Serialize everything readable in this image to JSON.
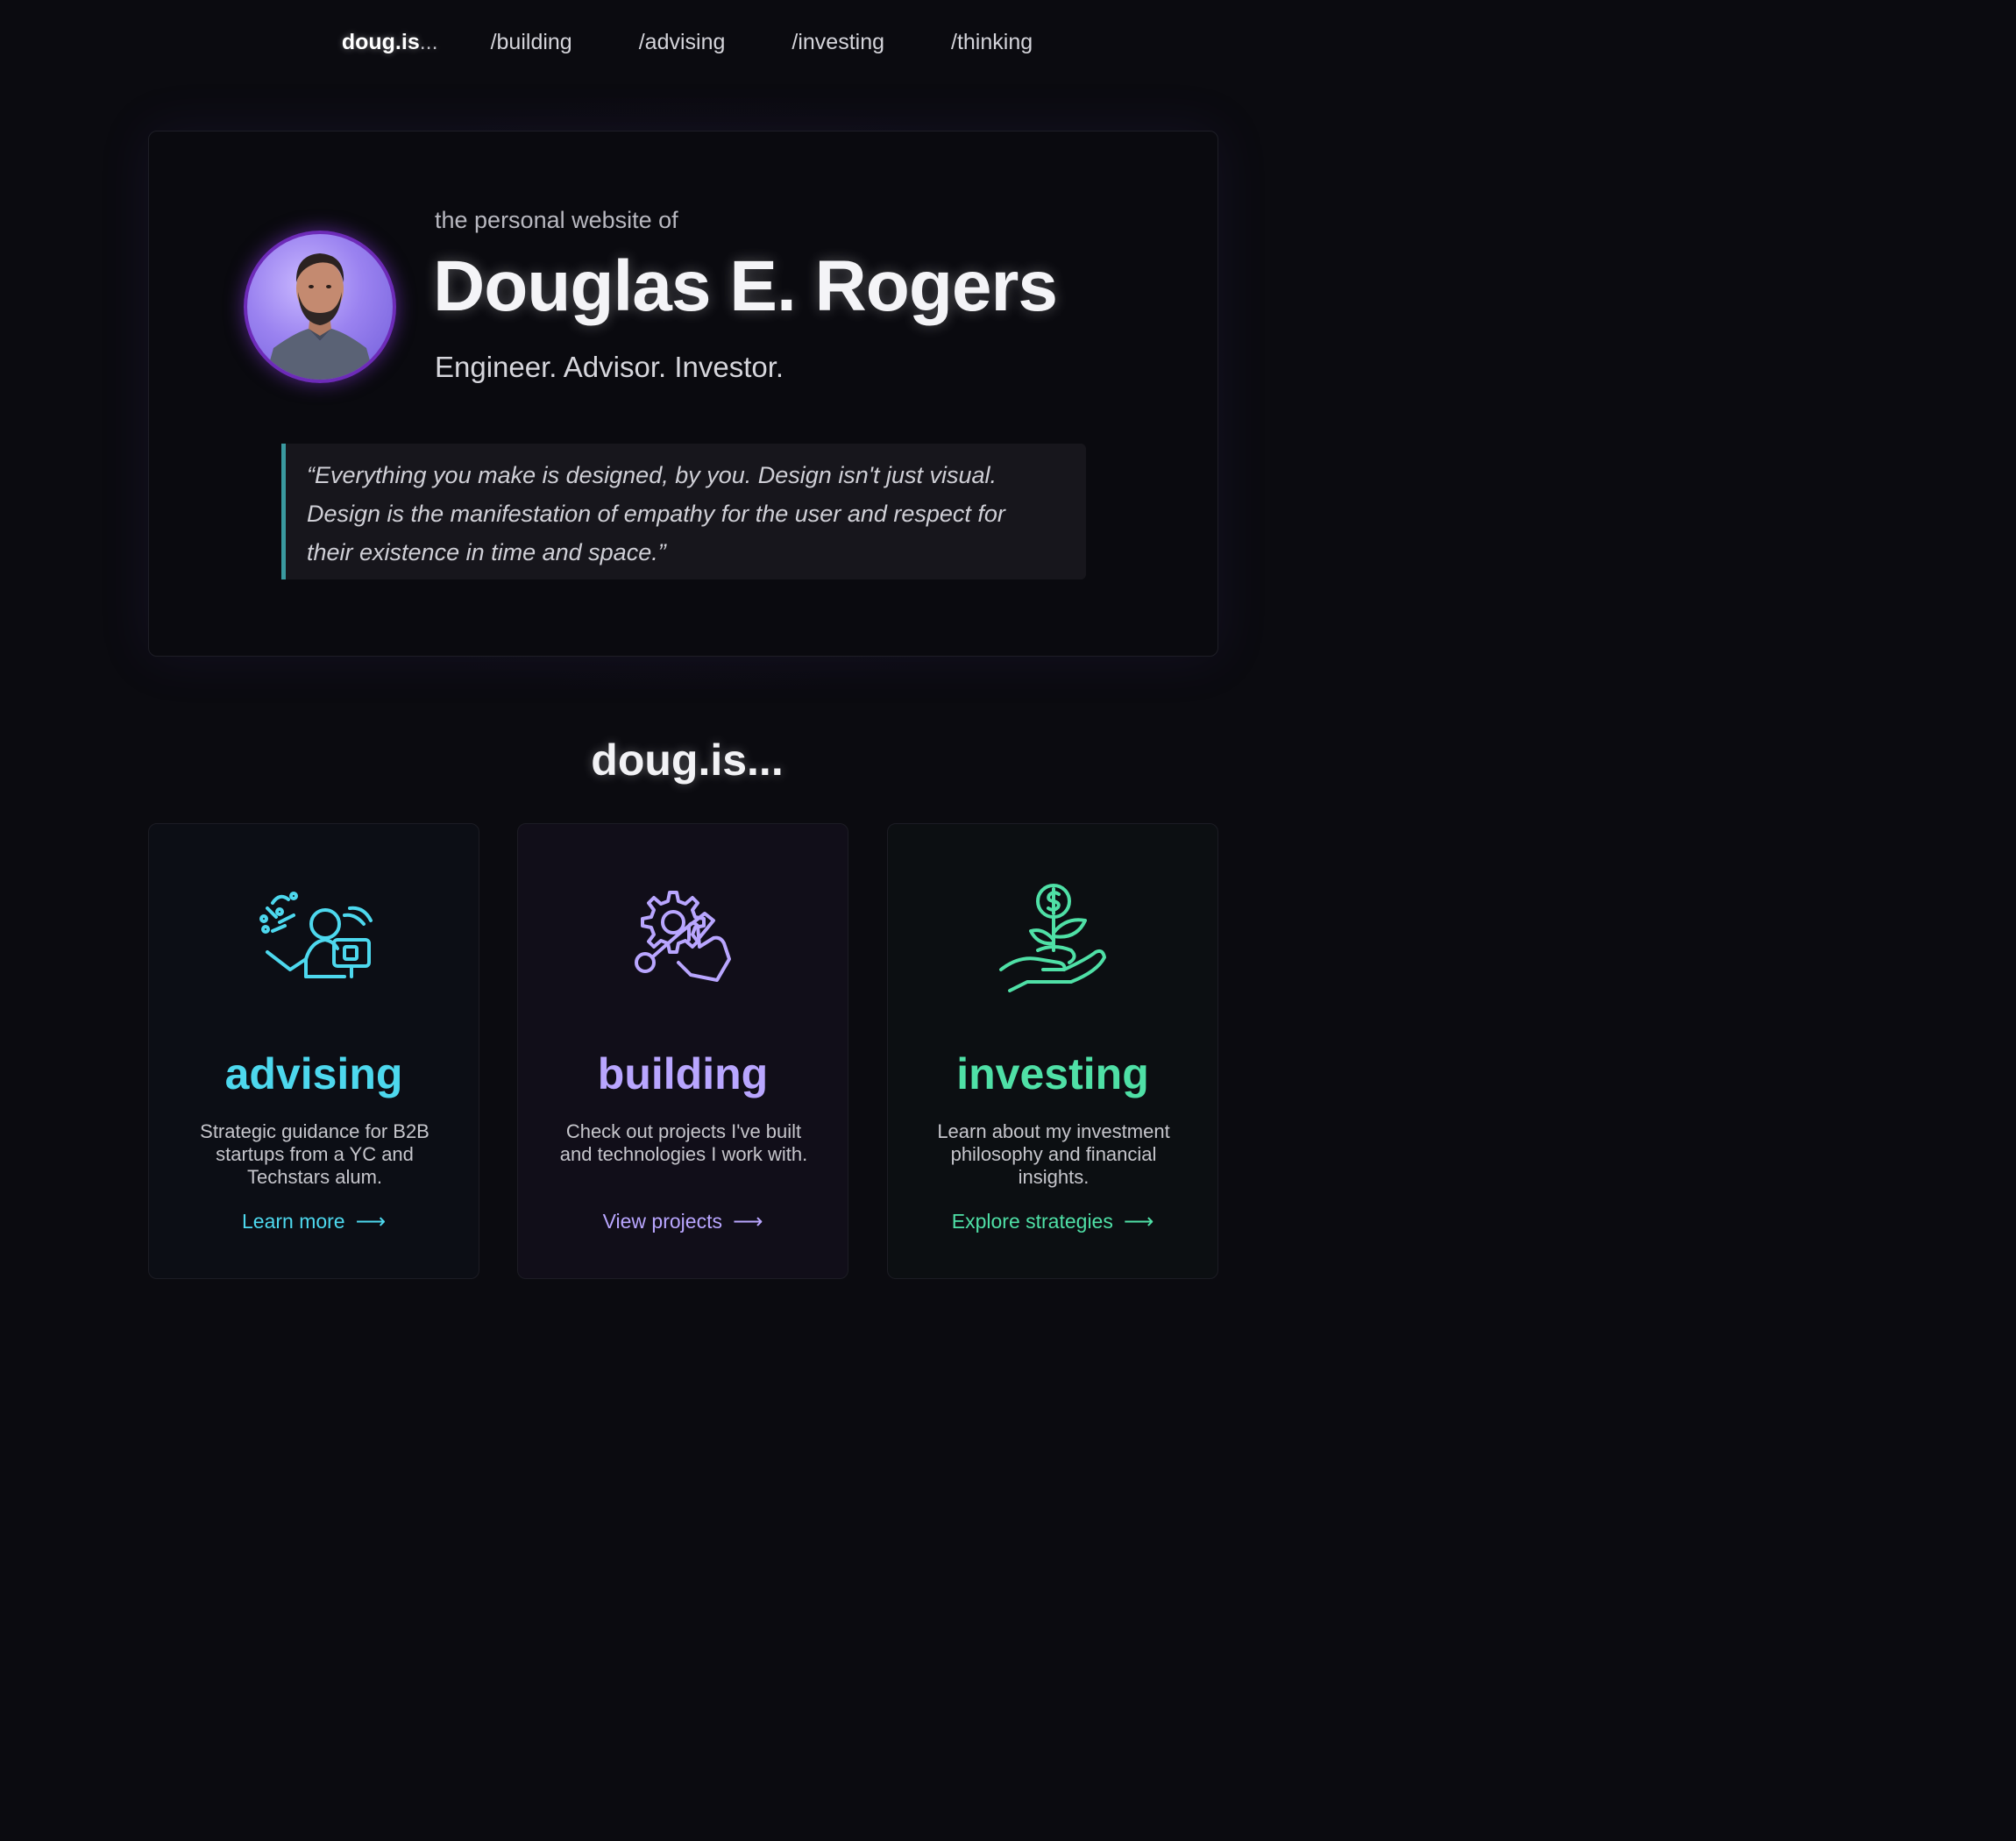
{
  "nav": {
    "brand": "doug.is",
    "brand_suffix": "...",
    "items": [
      {
        "label": "/building"
      },
      {
        "label": "/advising"
      },
      {
        "label": "/investing"
      },
      {
        "label": "/thinking"
      }
    ]
  },
  "hero": {
    "kicker": "the personal website of",
    "name": "Douglas E. Rogers",
    "tagline": "Engineer. Advisor. Investor.",
    "quote_line1": "“Everything you make is designed, by you. Design isn't just visual.",
    "quote_line2": "Design is the manifestation of empathy for the user and respect for",
    "quote_line3": "their existence in time and space.”"
  },
  "section": {
    "title": "doug.is..."
  },
  "cards": [
    {
      "icon": "advisor-presenting-icon",
      "title": "advising",
      "desc": "Strategic guidance for B2B startups from a YC and Techstars alum.",
      "link": "Learn more",
      "color": "#4dd8ee"
    },
    {
      "icon": "gear-wrench-hand-icon",
      "title": "building",
      "desc": "Check out projects I've built and technologies I work with.",
      "link": "View projects",
      "color": "#b9a6ff"
    },
    {
      "icon": "money-plant-hand-icon",
      "title": "investing",
      "desc": "Learn about my investment philosophy and financial insights.",
      "link": "Explore strategies",
      "color": "#4fe0a6"
    }
  ],
  "colors": {
    "background": "#0b0b10",
    "accent_cyan": "#4dd8ee",
    "accent_purple": "#b9a6ff",
    "accent_green": "#4fe0a6",
    "quote_border": "#3a9aa0",
    "avatar_ring": "#6d2bb8"
  }
}
